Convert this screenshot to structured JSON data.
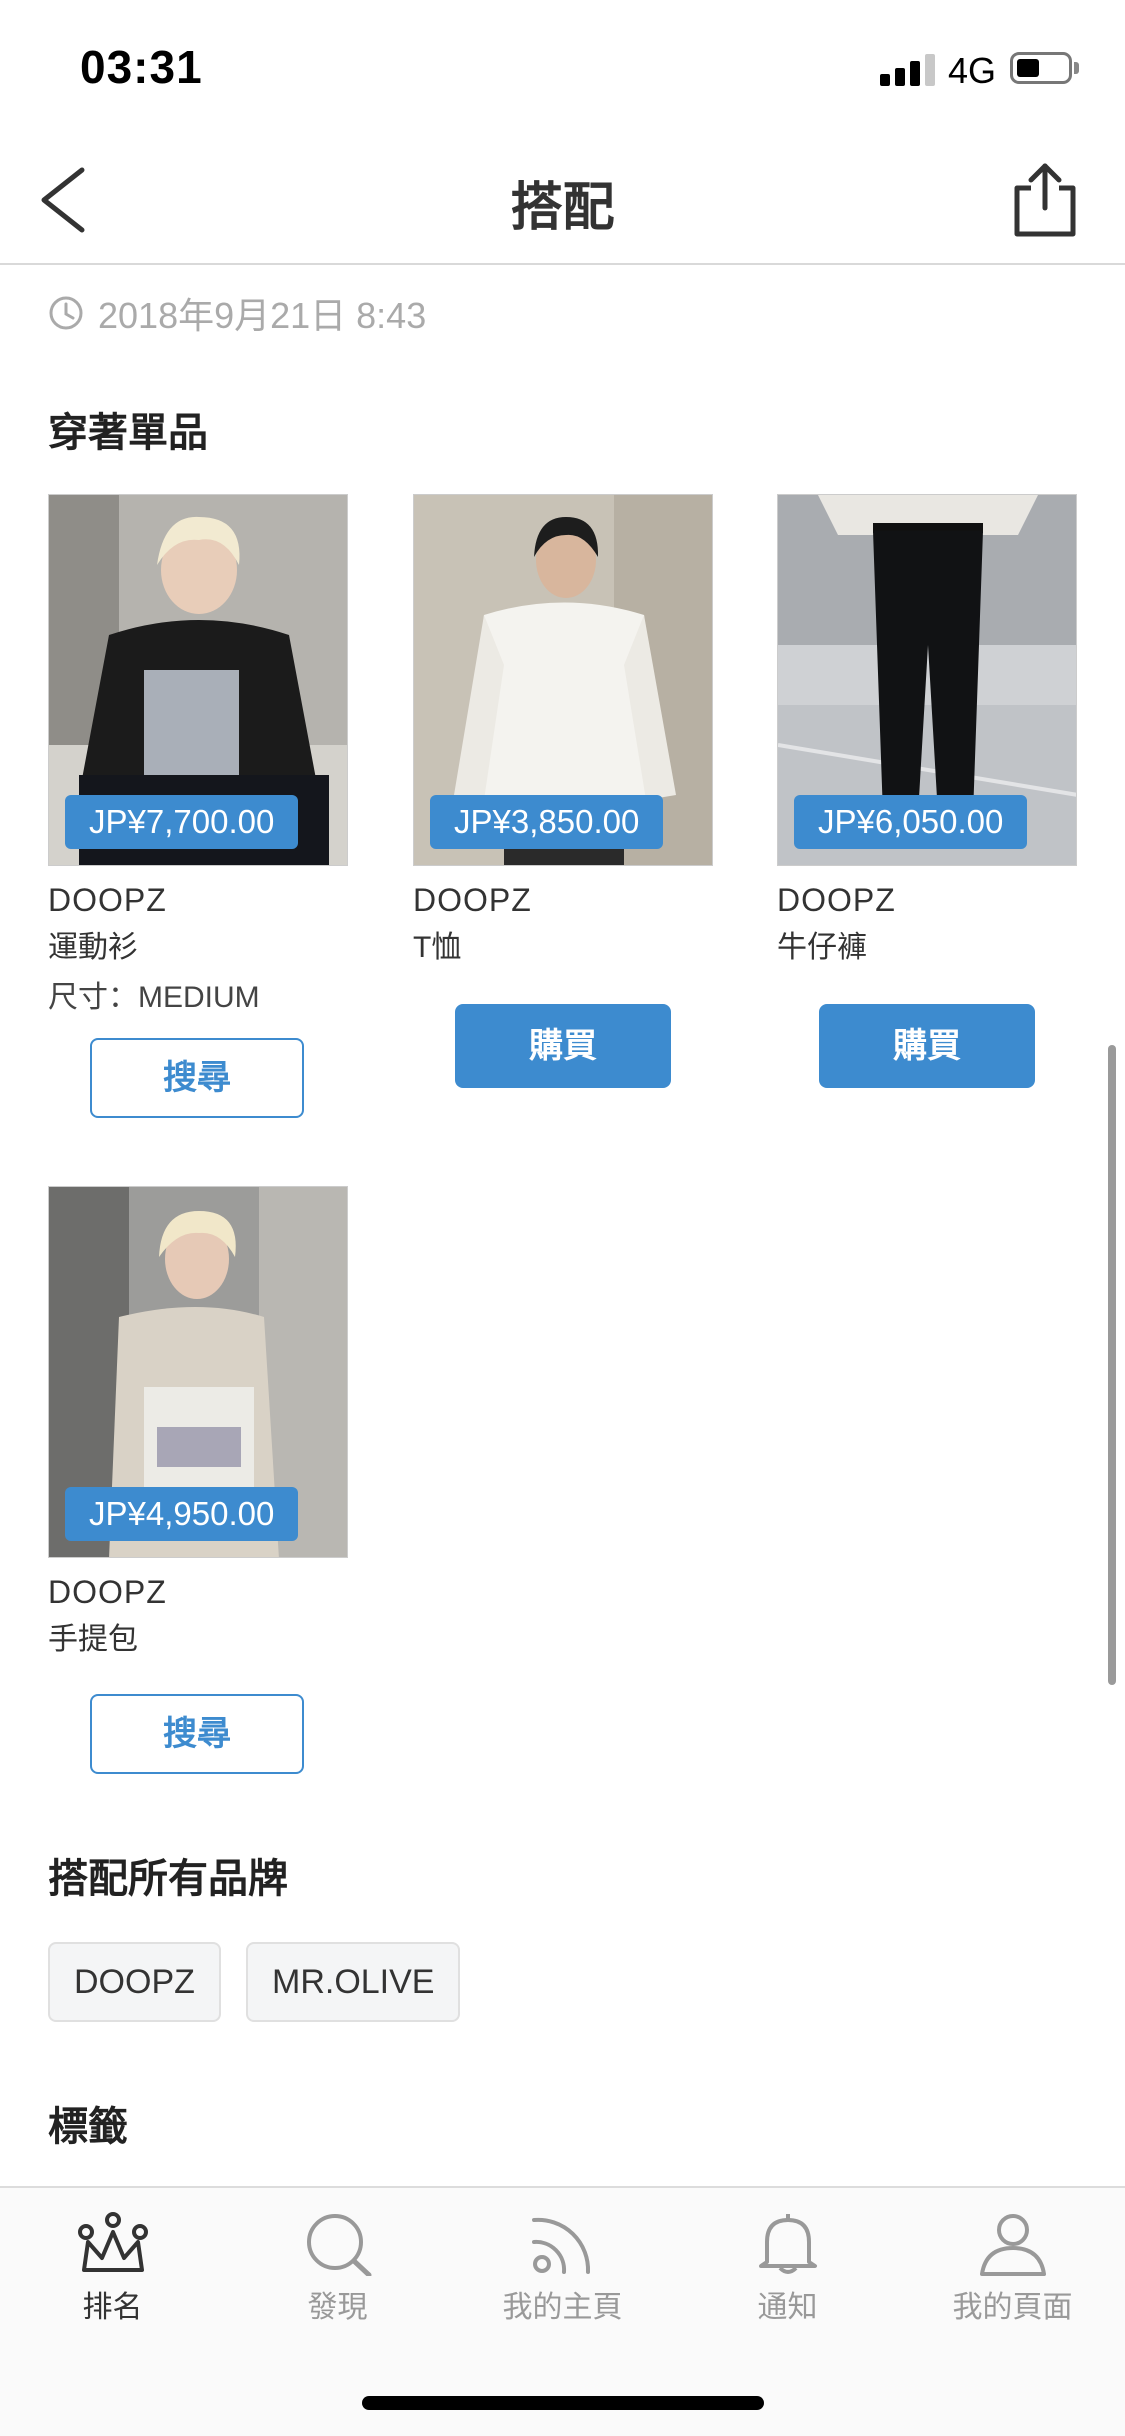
{
  "status_bar": {
    "time": "03:31",
    "network": "4G"
  },
  "nav": {
    "title": "搭配"
  },
  "post": {
    "date": "2018年9月21日 8:43"
  },
  "items_section": {
    "title": "穿著單品"
  },
  "items": [
    {
      "price": "JP¥7,700.00",
      "brand": "DOOPZ",
      "category": "運動衫",
      "size": "尺寸：MEDIUM",
      "action": "搜尋"
    },
    {
      "price": "JP¥3,850.00",
      "brand": "DOOPZ",
      "category": "T恤",
      "action": "購買"
    },
    {
      "price": "JP¥6,050.00",
      "brand": "DOOPZ",
      "category": "牛仔褲",
      "action": "購買"
    },
    {
      "price": "JP¥4,950.00",
      "brand": "DOOPZ",
      "category": "手提包",
      "action": "搜尋"
    }
  ],
  "brands_section": {
    "title": "搭配所有品牌",
    "brands": [
      "DOOPZ",
      "MR.OLIVE"
    ]
  },
  "tags_section": {
    "title": "標籤"
  },
  "tab_bar": {
    "tabs": [
      {
        "label": "排名",
        "icon": "crown-icon",
        "active": true
      },
      {
        "label": "發現",
        "icon": "search-icon",
        "active": false
      },
      {
        "label": "我的主頁",
        "icon": "feed-icon",
        "active": false
      },
      {
        "label": "通知",
        "icon": "bell-icon",
        "active": false
      },
      {
        "label": "我的頁面",
        "icon": "user-icon",
        "active": false
      }
    ]
  },
  "colors": {
    "accent": "#3d8bcf",
    "muted_text": "#aaaaaa"
  }
}
